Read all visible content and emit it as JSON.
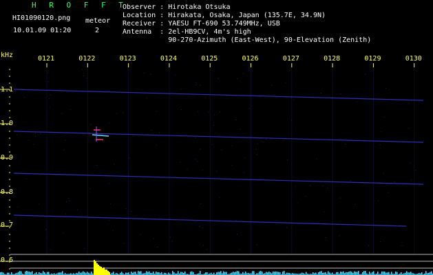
{
  "header": {
    "app_name": "H R O F F T",
    "filename": "HI01090120.png",
    "datetime": "10.01.09 01:20",
    "meteor_label": "meteor",
    "meteor_count": "2",
    "observer": "Observer : Hirotaka Otsuka",
    "location": "Location : Hirakata, Osaka, Japan (135.7E, 34.9N)",
    "receiver": "Receiver : YAESU FT-690 53.749MHz, USB",
    "antenna": "Antenna  : 2el-HB9CV, 4m's high",
    "antenna2": "           90-270-Azimuth (East-West), 90-Elevation (Zenith)"
  },
  "axis": {
    "unit": "kHz",
    "time_ticks": [
      "0121",
      "0122",
      "0123",
      "0124",
      "0125",
      "0126",
      "0127",
      "0128",
      "0129",
      "0130"
    ],
    "freq_ticks": [
      "1.1",
      "1.0",
      "0.9",
      "0.8",
      "0.7",
      "0.6"
    ]
  },
  "colors": {
    "background": "#000000",
    "header_text": "#ffffff",
    "title": "#33ff66",
    "ticks": "#ffff66",
    "carrier_lines": "#3333cc",
    "noise": "#66ddff",
    "meteor": "#ff3366"
  }
}
